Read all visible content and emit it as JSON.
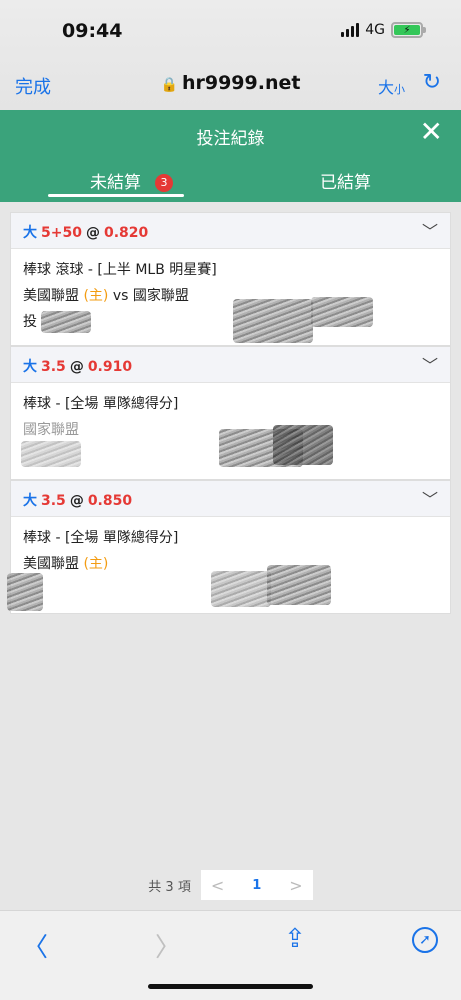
{
  "status": {
    "time": "09:44",
    "network": "4G"
  },
  "browser": {
    "done_label": "完成",
    "url": "hr9999.net",
    "text_size_big": "大",
    "text_size_small": "小",
    "reload_icon": "reload-icon"
  },
  "header": {
    "title": "投注紀錄",
    "tabs": [
      {
        "label": "未結算",
        "badge": "3",
        "active": true
      },
      {
        "label": "已結算",
        "active": false
      }
    ]
  },
  "bets": [
    {
      "pick": "大",
      "line": "5+50",
      "at": "@",
      "odds": "0.820",
      "market": "棒球 滾球 - [上半 MLB 明星賽]",
      "home_team": "美國聯盟",
      "home_tag": "(主)",
      "vs": "vs",
      "away_team": "國家聯盟",
      "extra": "投"
    },
    {
      "pick": "大",
      "line": "3.5",
      "at": "@",
      "odds": "0.910",
      "market": "棒球 - [全場 單隊總得分]",
      "team": "國家聯盟"
    },
    {
      "pick": "大",
      "line": "3.5",
      "at": "@",
      "odds": "0.850",
      "market": "棒球 - [全場 單隊總得分]",
      "team": "美國聯盟",
      "home_tag": "(主)"
    }
  ],
  "pager": {
    "total": "共 3 項",
    "prev": "<",
    "page": "1",
    "next": ">"
  },
  "colors": {
    "accent": "#3aa37b",
    "link": "#1a73e8",
    "red": "#e53935",
    "home": "#f39c12"
  }
}
